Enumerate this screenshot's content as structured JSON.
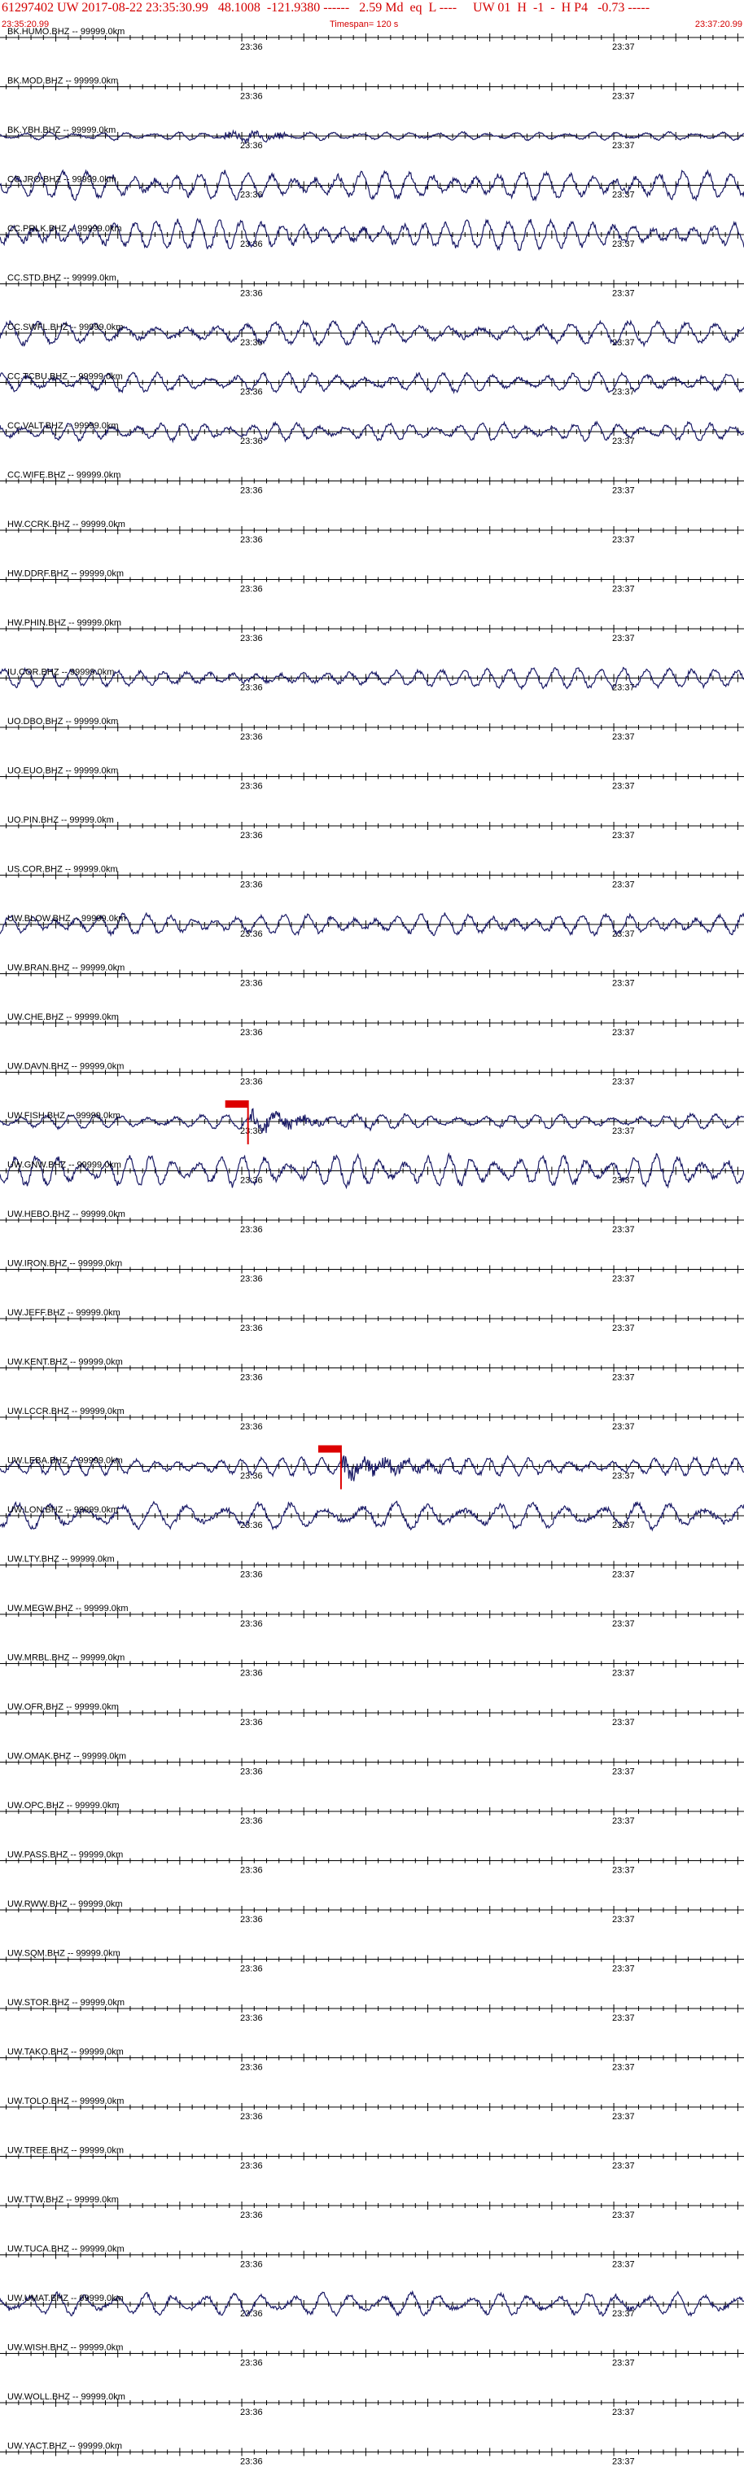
{
  "header": {
    "title": "61297402 UW 2017-08-22 23:35:30.99   48.1008  -121.9380 ------   2.59 Md  eq  L ----     UW 01  H  -1  -  H P4   -0.73 -----",
    "start_time": "23:35:20.99",
    "timespan": "Timespan= 120 s",
    "end_time": "23:37:20.99"
  },
  "chart_data": {
    "type": "line",
    "title": "",
    "time_tick_labels": [
      "23:36",
      "23:37"
    ],
    "trace_color": "#1a1a66",
    "pick_color": "#dd0000",
    "series": [
      {
        "name": "BK.HUMO.BHZ -- 99999.0km",
        "amplitude": 0
      },
      {
        "name": "BK.MOD.BHZ -- 99999.0km",
        "amplitude": 0
      },
      {
        "name": "BK.YBH.BHZ -- 99999.0km",
        "amplitude": 0.25
      },
      {
        "name": "CC.JRO.BHZ -- 99999.0km",
        "amplitude": 0.85
      },
      {
        "name": "CC.PRLK.BHZ -- 99999.0km",
        "amplitude": 0.9
      },
      {
        "name": "CC.STD.BHZ -- 99999.0km",
        "amplitude": 0
      },
      {
        "name": "CC.SWFL.BHZ -- 99999.0km",
        "amplitude": 0.7
      },
      {
        "name": "CC.TCBU.BHZ -- 99999.0km",
        "amplitude": 0.6
      },
      {
        "name": "CC.VALT.BHZ -- 99999.0km",
        "amplitude": 0.55
      },
      {
        "name": "CC.WIFE.BHZ -- 99999.0km",
        "amplitude": 0
      },
      {
        "name": "HW.CCRK.BHZ -- 99999.0km",
        "amplitude": 0
      },
      {
        "name": "HW.DDRF.BHZ -- 99999.0km",
        "amplitude": 0
      },
      {
        "name": "HW.PHIN.BHZ -- 99999.0km",
        "amplitude": 0
      },
      {
        "name": "IU.COR.BHZ -- 99999.0km",
        "amplitude": 0.6
      },
      {
        "name": "UO.DBO.BHZ -- 99999.0km",
        "amplitude": 0
      },
      {
        "name": "UO.EUO.BHZ -- 99999.0km",
        "amplitude": 0
      },
      {
        "name": "UO.PIN.BHZ -- 99999.0km",
        "amplitude": 0
      },
      {
        "name": "US.COR.BHZ -- 99999.0km",
        "amplitude": 0
      },
      {
        "name": "UW.BLOW.BHZ -- 99999.0km",
        "amplitude": 0.65
      },
      {
        "name": "UW.BRAN.BHZ -- 99999.0km",
        "amplitude": 0
      },
      {
        "name": "UW.CHE.BHZ -- 99999.0km",
        "amplitude": 0
      },
      {
        "name": "UW.DAVN.BHZ -- 99999.0km",
        "amplitude": 0
      },
      {
        "name": "UW.FISH.BHZ -- 99999.0km",
        "amplitude": 0.45,
        "pick_time": 40
      },
      {
        "name": "UW.GNW.BHZ -- 99999.0km",
        "amplitude": 0.95
      },
      {
        "name": "UW.HEBO.BHZ -- 99999.0km",
        "amplitude": 0
      },
      {
        "name": "UW.IRON.BHZ -- 99999.0km",
        "amplitude": 0
      },
      {
        "name": "UW.JEFF.BHZ -- 99999.0km",
        "amplitude": 0
      },
      {
        "name": "UW.KENT.BHZ -- 99999.0km",
        "amplitude": 0
      },
      {
        "name": "UW.LCCR.BHZ -- 99999.0km",
        "amplitude": 0
      },
      {
        "name": "UW.LEBA.BHZ -- 99999.0km",
        "amplitude": 0.55,
        "pick_time": 55
      },
      {
        "name": "UW.LON.BHZ -- 99999.0km",
        "amplitude": 0.8
      },
      {
        "name": "UW.LTY.BHZ -- 99999.0km",
        "amplitude": 0
      },
      {
        "name": "UW.MEGW.BHZ -- 99999.0km",
        "amplitude": 0
      },
      {
        "name": "UW.MRBL.BHZ -- 99999.0km",
        "amplitude": 0
      },
      {
        "name": "UW.OFR.BHZ -- 99999.0km",
        "amplitude": 0
      },
      {
        "name": "UW.OMAK.BHZ -- 99999.0km",
        "amplitude": 0
      },
      {
        "name": "UW.OPC.BHZ -- 99999.0km",
        "amplitude": 0
      },
      {
        "name": "UW.PASS.BHZ -- 99999.0km",
        "amplitude": 0
      },
      {
        "name": "UW.RWW.BHZ -- 99999.0km",
        "amplitude": 0
      },
      {
        "name": "UW.SQM.BHZ -- 99999.0km",
        "amplitude": 0
      },
      {
        "name": "UW.STOR.BHZ -- 99999.0km",
        "amplitude": 0
      },
      {
        "name": "UW.TAKO.BHZ -- 99999.0km",
        "amplitude": 0
      },
      {
        "name": "UW.TOLO.BHZ -- 99999.0km",
        "amplitude": 0
      },
      {
        "name": "UW.TREE.BHZ -- 99999.0km",
        "amplitude": 0
      },
      {
        "name": "UW.TTW.BHZ -- 99999.0km",
        "amplitude": 0
      },
      {
        "name": "UW.TUCA.BHZ -- 99999.0km",
        "amplitude": 0
      },
      {
        "name": "UW.UMAT.BHZ -- 99999.0km",
        "amplitude": 0.7
      },
      {
        "name": "UW.WISH.BHZ -- 99999.0km",
        "amplitude": 0
      },
      {
        "name": "UW.WOLL.BHZ -- 99999.0km",
        "amplitude": 0
      },
      {
        "name": "UW.YACT.BHZ -- 99999.0km",
        "amplitude": 0
      }
    ]
  }
}
